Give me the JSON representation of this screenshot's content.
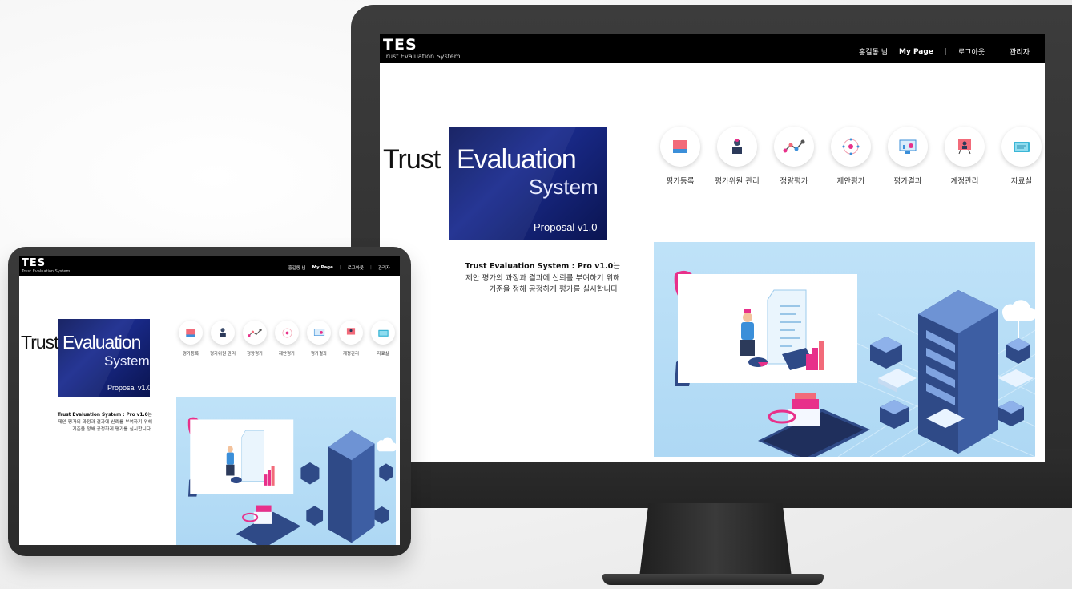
{
  "app": {
    "brand": "TES",
    "brand_subtitle": "Trust Evaluation System"
  },
  "nav": {
    "user": "홍길동 님",
    "mypage": "My Page",
    "logout": "로그아웃",
    "admin": "관리자",
    "separator": "|"
  },
  "logo": {
    "trust": "Trust",
    "evaluation": "Evaluation",
    "system": "System",
    "proposal": "Proposal v1.0",
    "bg_color": "#0e1a5e"
  },
  "description": {
    "title": "Trust Evaluation System : Pro v1.0",
    "title_suffix": "는",
    "line2": "제안 평가의 과정과 결과에 신뢰를 부여하기 위해",
    "line3": "기준을 정해 공정하게 평가를 실시합니다."
  },
  "menu": [
    {
      "label": "평가등록",
      "icon": "register-icon"
    },
    {
      "label": "평가위원 관리",
      "icon": "evaluator-icon"
    },
    {
      "label": "정량평가",
      "icon": "quantitative-icon"
    },
    {
      "label": "제안평가",
      "icon": "proposal-icon"
    },
    {
      "label": "평가결과",
      "icon": "result-icon"
    },
    {
      "label": "계정관리",
      "icon": "account-icon"
    },
    {
      "label": "자료실",
      "icon": "archive-icon"
    }
  ],
  "colors": {
    "topbar": "#000000",
    "accent_pink": "#e8308a",
    "illustration_bg": "#bfe2f8",
    "server_blue": "#2f4a87"
  }
}
